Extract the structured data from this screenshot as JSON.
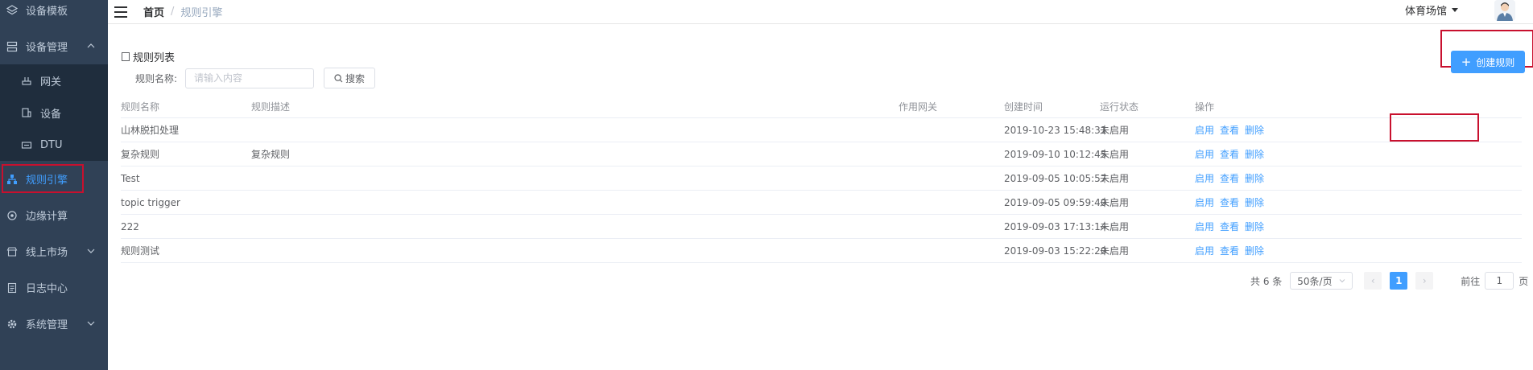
{
  "sidebar": {
    "items": [
      {
        "label": "设备模板",
        "icon": "layers-icon"
      },
      {
        "label": "设备管理",
        "icon": "server-icon"
      },
      {
        "label": "网关",
        "icon": "gateway-icon"
      },
      {
        "label": "设备",
        "icon": "device-icon"
      },
      {
        "label": "DTU",
        "icon": "dtu-icon"
      },
      {
        "label": "规则引擎",
        "icon": "rule-engine-icon"
      },
      {
        "label": "边缘计算",
        "icon": "edge-compute-icon"
      },
      {
        "label": "线上市场",
        "icon": "market-icon"
      },
      {
        "label": "日志中心",
        "icon": "log-icon"
      },
      {
        "label": "系统管理",
        "icon": "gear-icon"
      }
    ]
  },
  "header": {
    "breadcrumb_home": "首页",
    "breadcrumb_sep": "/",
    "breadcrumb_current": "规则引擎",
    "venue": "体育场馆"
  },
  "main": {
    "title": "规则列表",
    "create_button": "创建规则",
    "search_label": "规则名称:",
    "search_placeholder": "请输入内容",
    "search_button": "搜索"
  },
  "table": {
    "columns": [
      "规则名称",
      "规则描述",
      "作用网关",
      "创建时间",
      "运行状态",
      "操作"
    ],
    "rows": [
      {
        "name": "山林脱扣处理",
        "desc": "",
        "gateway": "",
        "created": "2019-10-23 15:48:31",
        "status": "未启用"
      },
      {
        "name": "复杂规则",
        "desc": "复杂规则",
        "gateway": "",
        "created": "2019-09-10 10:12:45",
        "status": "未启用"
      },
      {
        "name": "Test",
        "desc": "",
        "gateway": "",
        "created": "2019-09-05 10:05:57",
        "status": "未启用"
      },
      {
        "name": "topic trigger",
        "desc": "",
        "gateway": "",
        "created": "2019-09-05 09:59:40",
        "status": "未启用"
      },
      {
        "name": "222",
        "desc": "",
        "gateway": "",
        "created": "2019-09-03 17:13:14",
        "status": "未启用"
      },
      {
        "name": "规则测试",
        "desc": "",
        "gateway": "",
        "created": "2019-09-03 15:22:20",
        "status": "未启用"
      }
    ],
    "actions": [
      "启用",
      "查看",
      "删除"
    ]
  },
  "pager": {
    "total": "共 6 条",
    "page_size": "50条/页",
    "current_page": "1",
    "goto_prefix": "前往",
    "goto_value": "1",
    "goto_suffix": "页"
  },
  "colors": {
    "accent": "#409eff",
    "sidebar": "#304156",
    "highlight": "#c8102e"
  }
}
